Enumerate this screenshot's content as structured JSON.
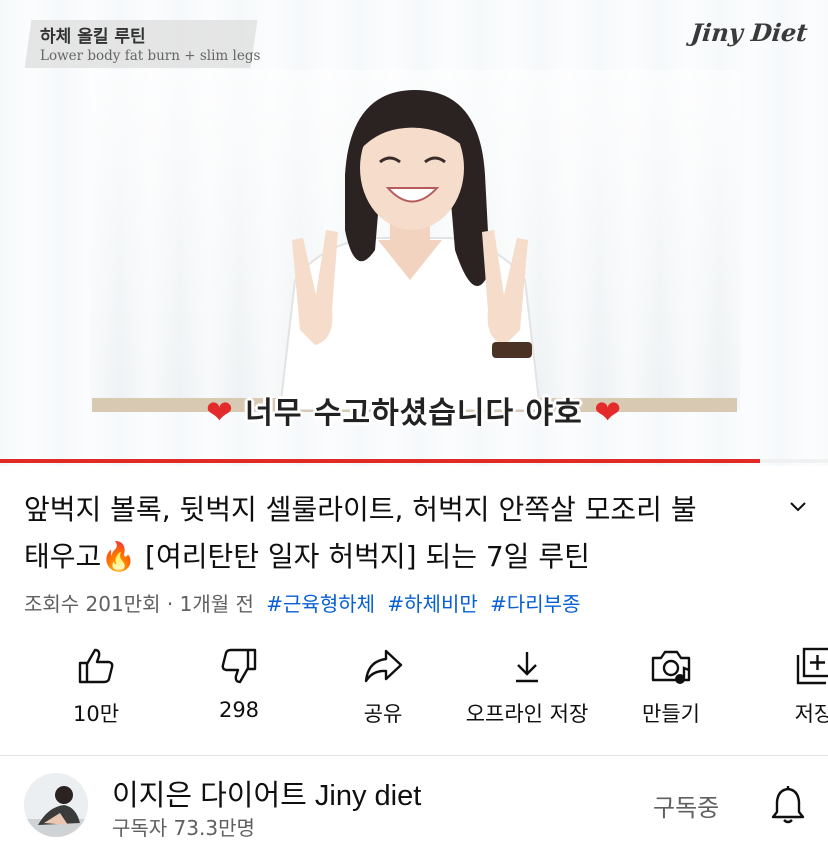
{
  "video": {
    "overlay_title": "하체 올킬 루틴",
    "overlay_subtitle": "Lower body fat burn + slim legs",
    "brand": "Jiny Diet",
    "caption": "너무 수고하셨습니다 야호",
    "caption_heart": "❤",
    "progress": 0.918
  },
  "title": {
    "line1": "앞벅지 볼록, 뒷벅지 셀룰라이트, 허벅지 안쪽살 모조리 불",
    "line2_a": "태우고",
    "line2_emoji": "🔥",
    "line2_b": " [여리탄탄 일자 허벅지] 되는 7일 루틴"
  },
  "meta": {
    "views": "조회수 201만회",
    "separator": " · ",
    "age": "1개월 전",
    "tags": [
      "#근육형하체",
      "#하체비만",
      "#다리부종"
    ]
  },
  "actions": [
    {
      "id": "like",
      "label": "10만",
      "icon": "thumb-up-icon"
    },
    {
      "id": "dislike",
      "label": "298",
      "icon": "thumb-down-icon"
    },
    {
      "id": "share",
      "label": "공유",
      "icon": "share-icon"
    },
    {
      "id": "download",
      "label": "오프라인 저장",
      "icon": "download-icon"
    },
    {
      "id": "remix",
      "label": "만들기",
      "icon": "remix-camera-icon"
    },
    {
      "id": "save",
      "label": "저장",
      "icon": "playlist-add-icon"
    }
  ],
  "channel": {
    "name": "이지은 다이어트 Jiny diet",
    "subscribers": "구독자 73.3만명",
    "subscribe_state": "구독중"
  },
  "colors": {
    "progress": "#e12a26",
    "link": "#065fd4",
    "secondary_text": "#606060"
  }
}
